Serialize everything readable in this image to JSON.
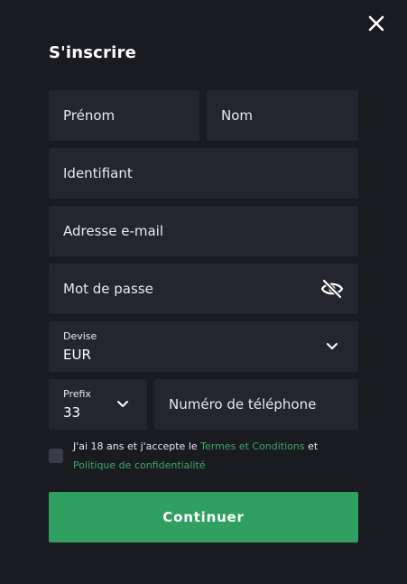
{
  "modal": {
    "title": "S'inscrire",
    "close_icon": "close-icon"
  },
  "form": {
    "first_name": {
      "placeholder": "Prénom",
      "value": ""
    },
    "last_name": {
      "placeholder": "Nom",
      "value": ""
    },
    "username": {
      "placeholder": "Identifiant",
      "value": ""
    },
    "email": {
      "placeholder": "Adresse e-mail",
      "value": ""
    },
    "password": {
      "placeholder": "Mot de passe",
      "value": "",
      "toggle_icon": "eye-off-icon"
    },
    "currency": {
      "label": "Devise",
      "value": "EUR",
      "icon": "chevron-down-icon"
    },
    "prefix": {
      "label": "Prefix",
      "value": "33",
      "icon": "chevron-down-icon"
    },
    "phone": {
      "placeholder": "Numéro de téléphone",
      "value": ""
    }
  },
  "terms": {
    "checked": false,
    "text_before": "J'ai 18 ans et j'accepte le ",
    "terms_link": "Termes et Conditions",
    "text_between": " et",
    "privacy_link": "Politique de confidentialité"
  },
  "submit": {
    "label": "Continuer"
  },
  "colors": {
    "background": "#1a1b21",
    "field": "#24252f",
    "accent": "#2fa060",
    "link": "#3aa866",
    "checkbox": "#3a3c4d"
  }
}
